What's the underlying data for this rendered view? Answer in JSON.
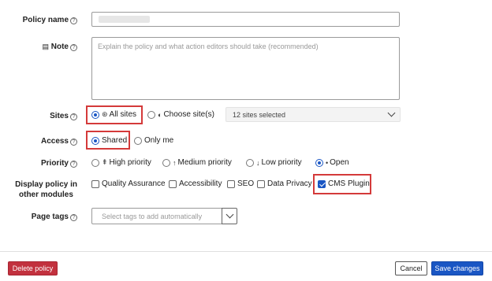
{
  "fields": {
    "policy_name": {
      "label": "Policy name"
    },
    "note": {
      "label": "Note",
      "placeholder": "Explain the policy and what action editors should take (recommended)"
    },
    "sites": {
      "label": "Sites",
      "options": [
        "All sites",
        "Choose site(s)"
      ],
      "selected": "All sites",
      "dropdown_value": "12 sites selected"
    },
    "access": {
      "label": "Access",
      "options": [
        "Shared",
        "Only me"
      ],
      "selected": "Shared"
    },
    "priority": {
      "label": "Priority",
      "options": [
        {
          "label": "High priority",
          "icon": "double-up-arrow-icon",
          "glyph": "⇞"
        },
        {
          "label": "Medium priority",
          "icon": "up-arrow-icon",
          "glyph": "↑"
        },
        {
          "label": "Low priority",
          "icon": "down-arrow-icon",
          "glyph": "↓"
        },
        {
          "label": "Open",
          "icon": "dot-icon",
          "glyph": "•"
        }
      ],
      "selected": "Open"
    },
    "display_policy": {
      "label_line1": "Display policy in",
      "label_line2": "other modules",
      "options": [
        "Quality Assurance",
        "Accessibility",
        "SEO",
        "Data Privacy",
        "CMS Plugin"
      ],
      "checked": [
        "CMS Plugin"
      ]
    },
    "page_tags": {
      "label": "Page tags",
      "placeholder": "Select tags to add automatically"
    }
  },
  "footer": {
    "delete_label": "Delete policy",
    "cancel_label": "Cancel",
    "save_label": "Save changes"
  },
  "colors": {
    "highlight": "#d43a3a",
    "primary": "#1a56c4",
    "danger": "#c2313e"
  },
  "help_glyph": "?"
}
